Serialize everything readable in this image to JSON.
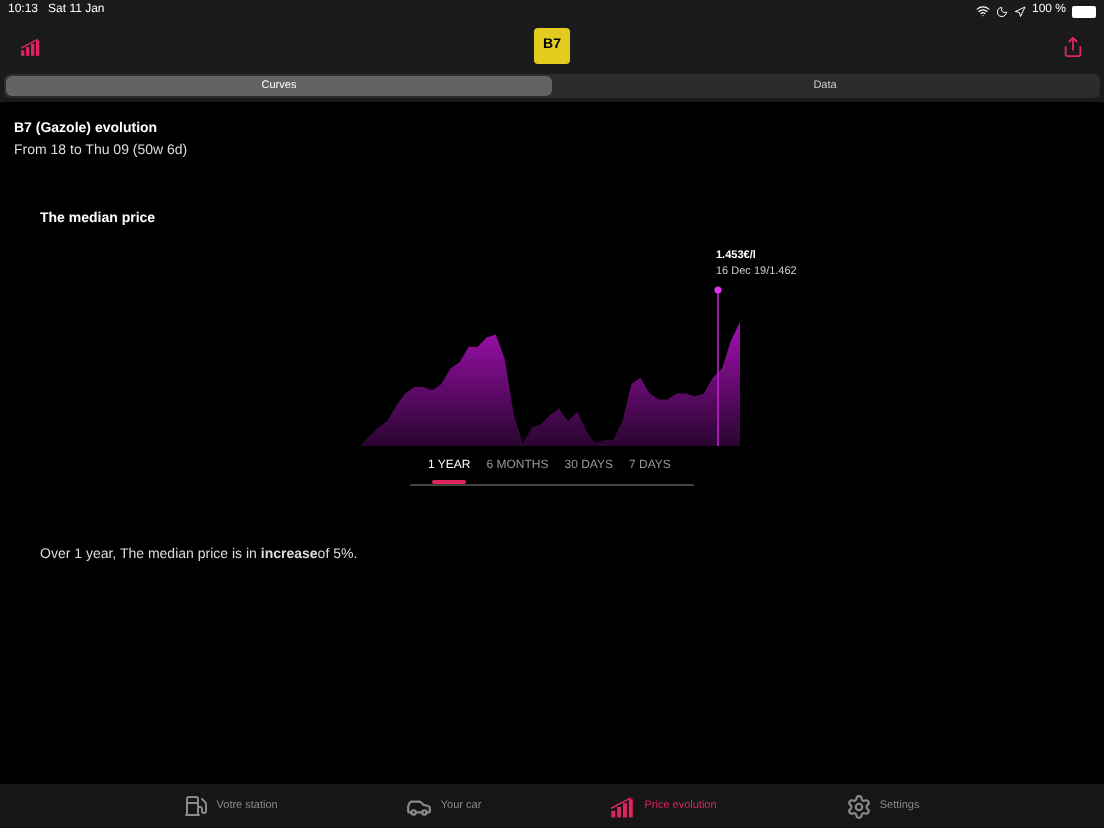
{
  "status_bar": {
    "time": "10:13",
    "date": "Sat 11 Jan",
    "battery": "100 %"
  },
  "header": {
    "fuel_badge": "B7"
  },
  "tabs": [
    {
      "label": "Curves",
      "selected": true
    },
    {
      "label": "Data",
      "selected": false
    }
  ],
  "title": "B7 (Gazole) evolution",
  "subtitle": "From 18 to Thu 09 (50w 6d)",
  "chart": {
    "title": "The median price",
    "tooltip_value": "1.453€/l",
    "tooltip_detail": "16 Dec 19/1.462"
  },
  "ranges": [
    {
      "label": "1 YEAR",
      "selected": true
    },
    {
      "label": "6 MONTHS",
      "selected": false
    },
    {
      "label": "30 DAYS",
      "selected": false
    },
    {
      "label": "7 DAYS",
      "selected": false
    }
  ],
  "summary": "Over 1 year, The median price is in **increase**of 5%.",
  "bottom_tabs": [
    {
      "label": "Votre station",
      "kind": "station",
      "selected": false
    },
    {
      "label": "Your car",
      "kind": "car",
      "selected": false
    },
    {
      "label": "Price evolution",
      "kind": "chart",
      "selected": true
    },
    {
      "label": "Settings",
      "kind": "settings",
      "selected": false
    }
  ]
}
